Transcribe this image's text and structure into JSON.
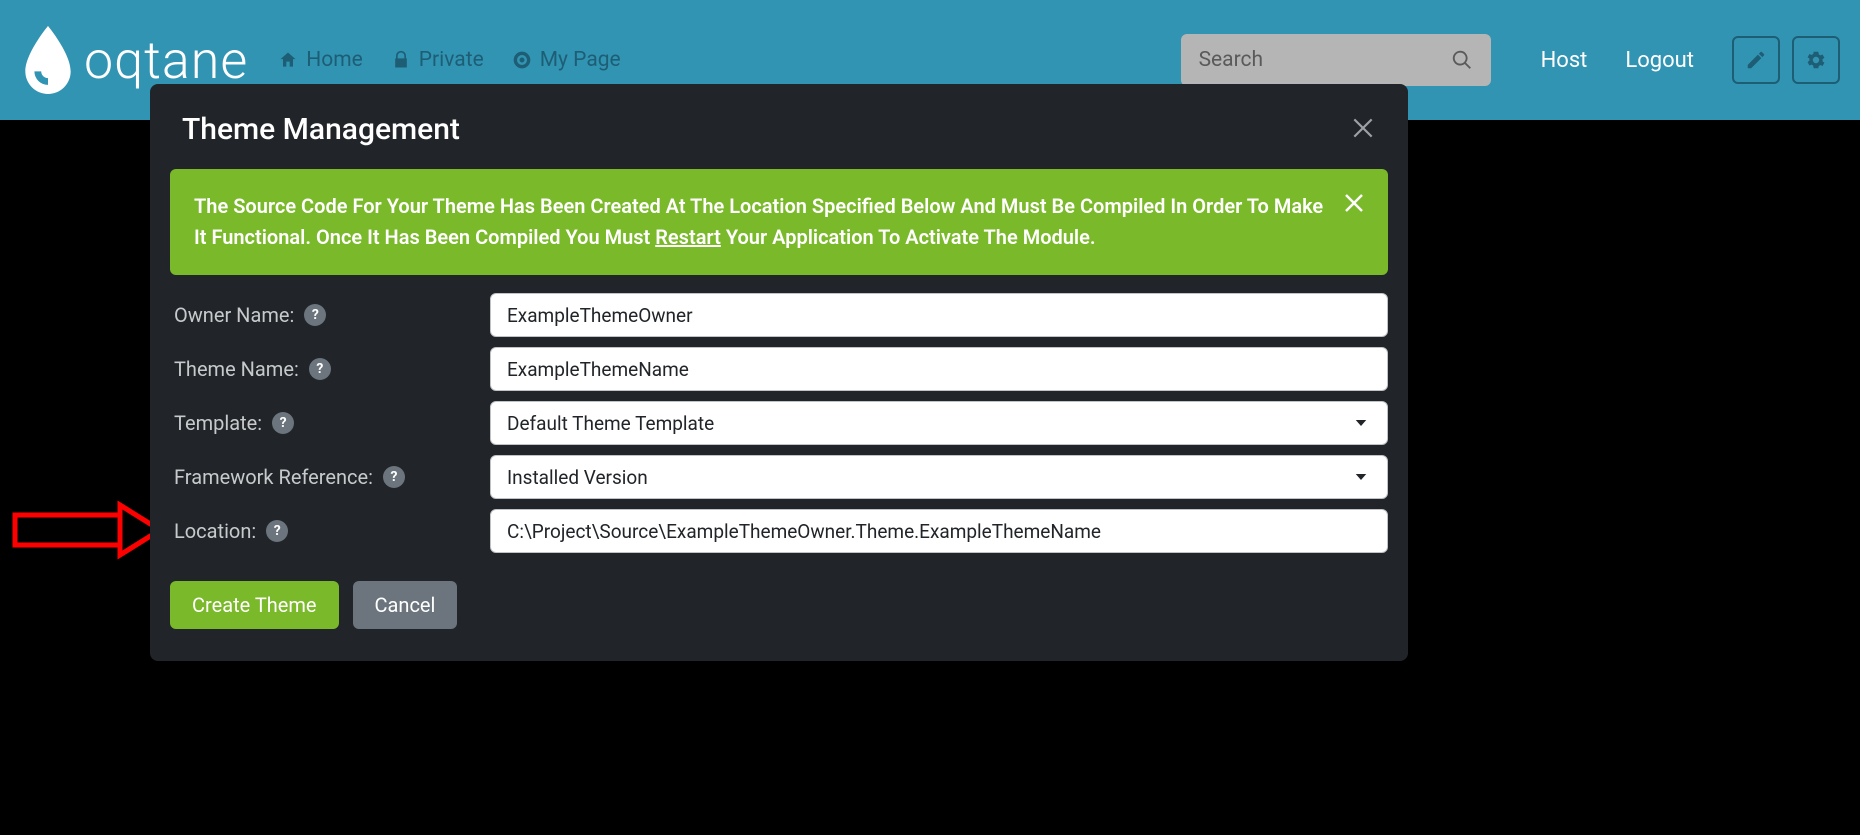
{
  "brand": {
    "name": "oqtane"
  },
  "nav": {
    "items": [
      {
        "label": "Home"
      },
      {
        "label": "Private"
      },
      {
        "label": "My Page"
      }
    ]
  },
  "search": {
    "placeholder": "Search"
  },
  "header_links": {
    "host": "Host",
    "logout": "Logout"
  },
  "modal": {
    "title": "Theme Management",
    "alert": {
      "pre": "The Source Code For Your Theme Has Been Created At The Location Specified Below And Must Be Compiled In Order To Make It Functional. Once It Has Been Compiled You Must ",
      "link": "Restart",
      "post": " Your Application To Activate The Module."
    },
    "fields": {
      "owner_name": {
        "label": "Owner Name:",
        "value": "ExampleThemeOwner"
      },
      "theme_name": {
        "label": "Theme Name:",
        "value": "ExampleThemeName"
      },
      "template": {
        "label": "Template:",
        "value": "Default Theme Template"
      },
      "framework": {
        "label": "Framework Reference:",
        "value": "Installed Version"
      },
      "location": {
        "label": "Location:",
        "value": "C:\\Project\\Source\\ExampleThemeOwner.Theme.ExampleThemeName"
      }
    },
    "actions": {
      "create": "Create Theme",
      "cancel": "Cancel"
    }
  }
}
